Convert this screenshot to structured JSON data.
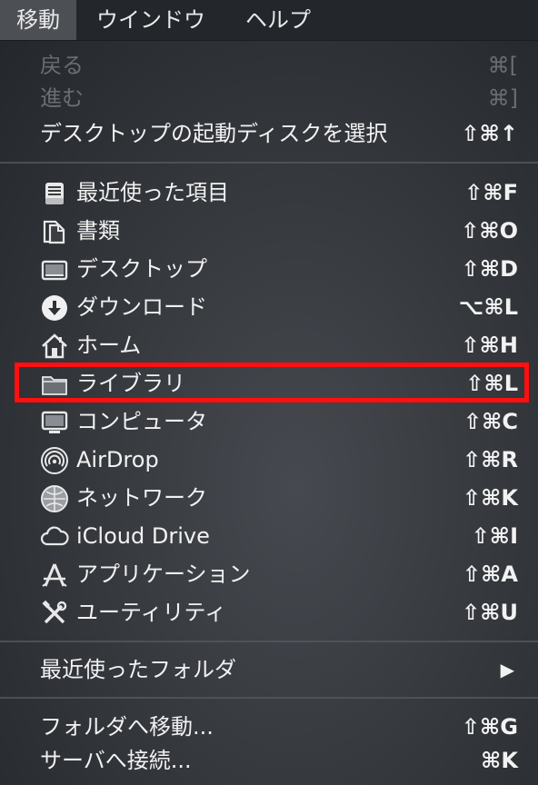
{
  "menubar": {
    "items": [
      {
        "label": "移動",
        "active": true
      },
      {
        "label": "ウインドウ"
      },
      {
        "label": "ヘルプ"
      }
    ]
  },
  "menu": {
    "back": {
      "label": "戻る",
      "shortcut": "⌘[",
      "enabled": false
    },
    "forward": {
      "label": "進む",
      "shortcut": "⌘]",
      "enabled": false
    },
    "startup_disk": {
      "label": "デスクトップの起動ディスクを選択",
      "shortcut": "⇧⌘↑"
    },
    "recents": {
      "label": "最近使った項目",
      "shortcut": "⇧⌘F",
      "icon": "recents-icon"
    },
    "documents": {
      "label": "書類",
      "shortcut": "⇧⌘O",
      "icon": "documents-icon"
    },
    "desktop": {
      "label": "デスクトップ",
      "shortcut": "⇧⌘D",
      "icon": "desktop-icon"
    },
    "downloads": {
      "label": "ダウンロード",
      "shortcut": "⌥⌘L",
      "icon": "download-icon"
    },
    "home": {
      "label": "ホーム",
      "shortcut": "⇧⌘H",
      "icon": "home-icon"
    },
    "library": {
      "label": "ライブラリ",
      "shortcut": "⇧⌘L",
      "icon": "folder-icon",
      "highlighted": true
    },
    "computer": {
      "label": "コンピュータ",
      "shortcut": "⇧⌘C",
      "icon": "computer-icon"
    },
    "airdrop": {
      "label": "AirDrop",
      "shortcut": "⇧⌘R",
      "icon": "airdrop-icon"
    },
    "network": {
      "label": "ネットワーク",
      "shortcut": "⇧⌘K",
      "icon": "network-icon"
    },
    "icloud": {
      "label": "iCloud Drive",
      "shortcut": "⇧⌘I",
      "icon": "cloud-icon"
    },
    "applications": {
      "label": "アプリケーション",
      "shortcut": "⇧⌘A",
      "icon": "applications-icon"
    },
    "utilities": {
      "label": "ユーティリティ",
      "shortcut": "⇧⌘U",
      "icon": "utilities-icon"
    },
    "recent_folders": {
      "label": "最近使ったフォルダ",
      "submenu_arrow": "▶"
    },
    "go_to_folder": {
      "label": "フォルダへ移動...",
      "shortcut": "⇧⌘G"
    },
    "connect_server": {
      "label": "サーバへ接続...",
      "shortcut": "⌘K"
    }
  },
  "colors": {
    "highlight_border": "#ff1010",
    "menu_text": "#f2f2f2",
    "disabled_text": "#6a6d72"
  }
}
